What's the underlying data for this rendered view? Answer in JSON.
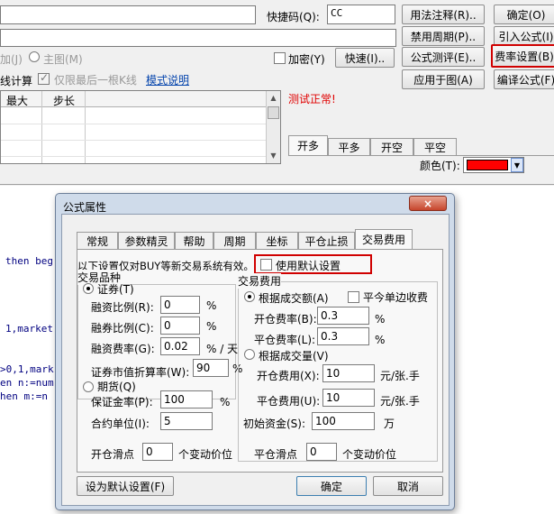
{
  "editor": {
    "shortcut_label": "快捷码(Q):",
    "shortcut_value": "CC",
    "row3_left": "加(J)",
    "main_chart": "主图(M)",
    "encrypt": "加密(Y)",
    "quick": "快速(I)..",
    "line_calc": "线计算",
    "last_kline_only": "仅限最后一根K线",
    "mode_help": "模式说明",
    "params_headers": [
      "最大",
      "步长"
    ],
    "status_text": "测试正常!",
    "buttons": {
      "usage_note": "用法注释(R)..",
      "confirm": "确定(O)",
      "disable_period": "禁用周期(P)..",
      "import_formula": "引入公式(I)",
      "formula_test": "公式测评(E)..",
      "fee_settings": "费率设置(B)",
      "apply_chart": "应用于图(A)",
      "compile_formula": "编译公式(F)"
    },
    "order_tabs": [
      "开多",
      "平多",
      "开空",
      "平空"
    ],
    "color_label": "颜色(T):",
    "color_value": "#ff0000"
  },
  "code_lines": [
    {
      "text": "then beg"
    },
    {
      "text": "1,market"
    },
    {
      "text": ">0,1,mark"
    },
    {
      "text": "en n:=num"
    },
    {
      "text": "hen  m:=n"
    }
  ],
  "dialog": {
    "title": "公式属性",
    "close_label": "×",
    "tabs": [
      "常规",
      "参数精灵",
      "帮助",
      "周期",
      "坐标",
      "平仓止损",
      "交易费用"
    ],
    "active_tab": 6,
    "note": "以下设置仅对BUY等新交易系统有效。",
    "use_default": "使用默认设置",
    "securities_group": "交易品种",
    "securities": "证券(T)",
    "margin_buy_ratio_label": "融资比例(R):",
    "margin_buy_ratio": "0",
    "margin_sell_ratio_label": "融券比例(C):",
    "margin_sell_ratio": "0",
    "margin_rate_label": "融资费率(G):",
    "margin_rate": "0.02",
    "percent": "%",
    "percent_per_day": "% / 天",
    "mv_ratio_label": "证券市值折算率(W):",
    "mv_ratio": "90",
    "futures": "期货(Q)",
    "deposit_label": "保证金率(P):",
    "deposit": "100",
    "contract_unit_label": "合约单位(I):",
    "contract_unit": "5",
    "fee_group": "交易费用",
    "by_amount": "根据成交额(A)",
    "single_side": "平今单边收费",
    "open_rate_label": "开仓费率(B):",
    "open_rate": "0.3",
    "close_rate_label": "平仓费率(L):",
    "close_rate": "0.3",
    "by_volume": "根据成交量(V)",
    "open_fee_label": "开仓费用(X):",
    "open_fee": "10",
    "close_fee_label": "平仓费用(U):",
    "close_fee": "10",
    "fee_unit": "元/张.手",
    "init_capital_label": "初始资金(S):",
    "init_capital": "100",
    "wan": "万",
    "open_slip_label": "开仓滑点",
    "open_slip": "0",
    "close_slip_label": "平仓滑点",
    "close_slip": "0",
    "tick_unit": "个变动价位",
    "set_default": "设为默认设置(F)",
    "ok": "确定",
    "cancel": "取消"
  }
}
